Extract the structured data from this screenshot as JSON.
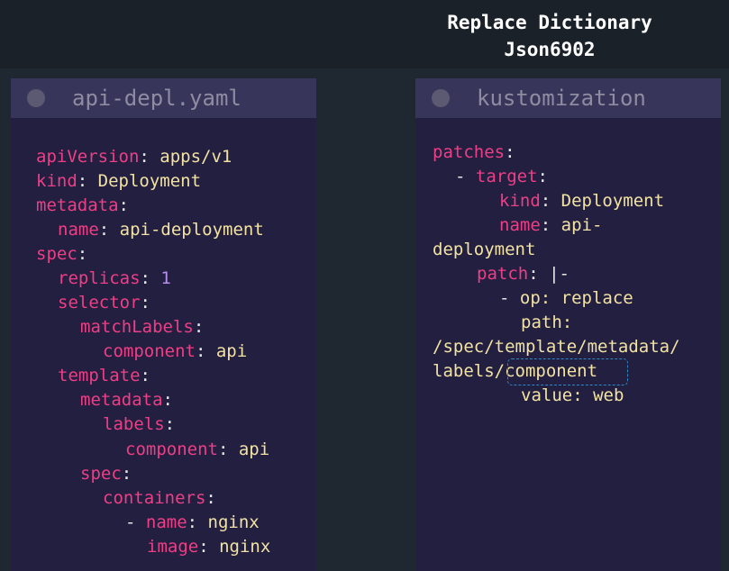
{
  "title": {
    "line1": "Replace Dictionary",
    "line2": "Json6902"
  },
  "left_panel": {
    "title": "api-depl.yaml",
    "lines": {
      "l0": {
        "key": "apiVersion",
        "sep": ": ",
        "val": "apps/v1"
      },
      "l1": {
        "key": "kind",
        "sep": ": ",
        "val": "Deployment"
      },
      "l2": {
        "key": "metadata",
        "sep": ":"
      },
      "l3": {
        "key": "name",
        "sep": ": ",
        "val": "api-deployment"
      },
      "l4": {
        "key": "spec",
        "sep": ":"
      },
      "l5": {
        "key": "replicas",
        "sep": ": ",
        "val": "1"
      },
      "l6": {
        "key": "selector",
        "sep": ":"
      },
      "l7": {
        "key": "matchLabels",
        "sep": ":"
      },
      "l8": {
        "key": "component",
        "sep": ": ",
        "val": "api"
      },
      "l9": {
        "key": "template",
        "sep": ":"
      },
      "l10": {
        "key": "metadata",
        "sep": ":"
      },
      "l11": {
        "key": "labels",
        "sep": ":"
      },
      "l12": {
        "key": "component",
        "sep": ": ",
        "val": "api"
      },
      "l13": {
        "key": "spec",
        "sep": ":"
      },
      "l14": {
        "key": "containers",
        "sep": ":"
      },
      "l15": {
        "dash": "- ",
        "key": "name",
        "sep": ": ",
        "val": "nginx"
      },
      "l16": {
        "key": "image",
        "sep": ": ",
        "val": "nginx"
      }
    }
  },
  "right_panel": {
    "title": "kustomization",
    "lines": {
      "r0": {
        "key": "patches",
        "sep": ":"
      },
      "r1": {
        "dash": "- ",
        "key": "target",
        "sep": ":"
      },
      "r2": {
        "key": "kind",
        "sep": ": ",
        "val": "Deployment"
      },
      "r3": {
        "key": "name",
        "sep": ": ",
        "val": "api-"
      },
      "r4": {
        "val": "deployment"
      },
      "r5": {
        "key": "patch",
        "sep": ": ",
        "val": "|-"
      },
      "r6": {
        "dash": "- ",
        "plain": "op: replace"
      },
      "r7": {
        "plain": "path:"
      },
      "r8": {
        "plain": "/spec/template/metadata/"
      },
      "r9": {
        "plain": "labels/component"
      },
      "r10": {
        "plain": "value: web"
      }
    }
  },
  "colors": {
    "background": "#1f2730",
    "panel": "#221f40",
    "panel_header": "#37355a",
    "key": "#ee3f86",
    "value": "#f2e2a3",
    "number": "#b98cf0",
    "highlight": "#2e89c7"
  }
}
